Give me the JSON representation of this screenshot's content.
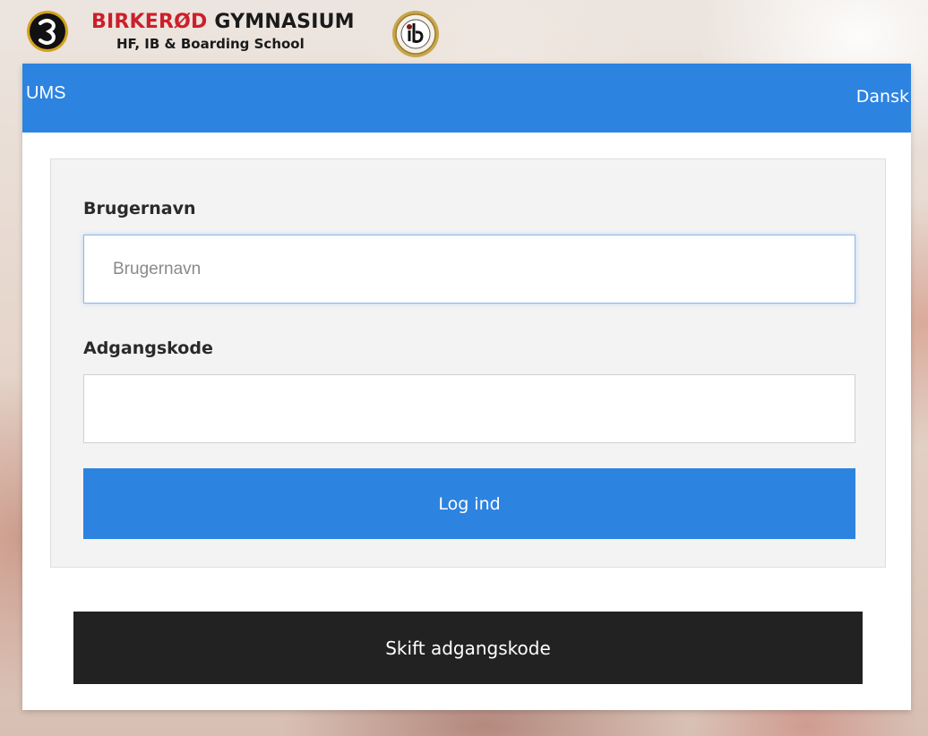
{
  "brand": {
    "title_red": "BIRKERØD",
    "title_dark": "GYMNASIUM",
    "subtitle": "HF, IB & Boarding School",
    "left_logo_icon": "birkerod-crest-logo",
    "right_logo_icon": "ib-seal-logo"
  },
  "header": {
    "title": "UMS",
    "language_link": "Dansk"
  },
  "form": {
    "username_label": "Brugernavn",
    "username_placeholder": "Brugernavn",
    "username_value": "",
    "password_label": "Adgangskode",
    "password_value": "",
    "login_button": "Log ind"
  },
  "change_password_button": "Skift adgangskode",
  "colors": {
    "primary": "#2d83e0",
    "brand_red": "#cc1f2b",
    "dark_button": "#222222",
    "panel_bg": "#f3f3f3"
  }
}
